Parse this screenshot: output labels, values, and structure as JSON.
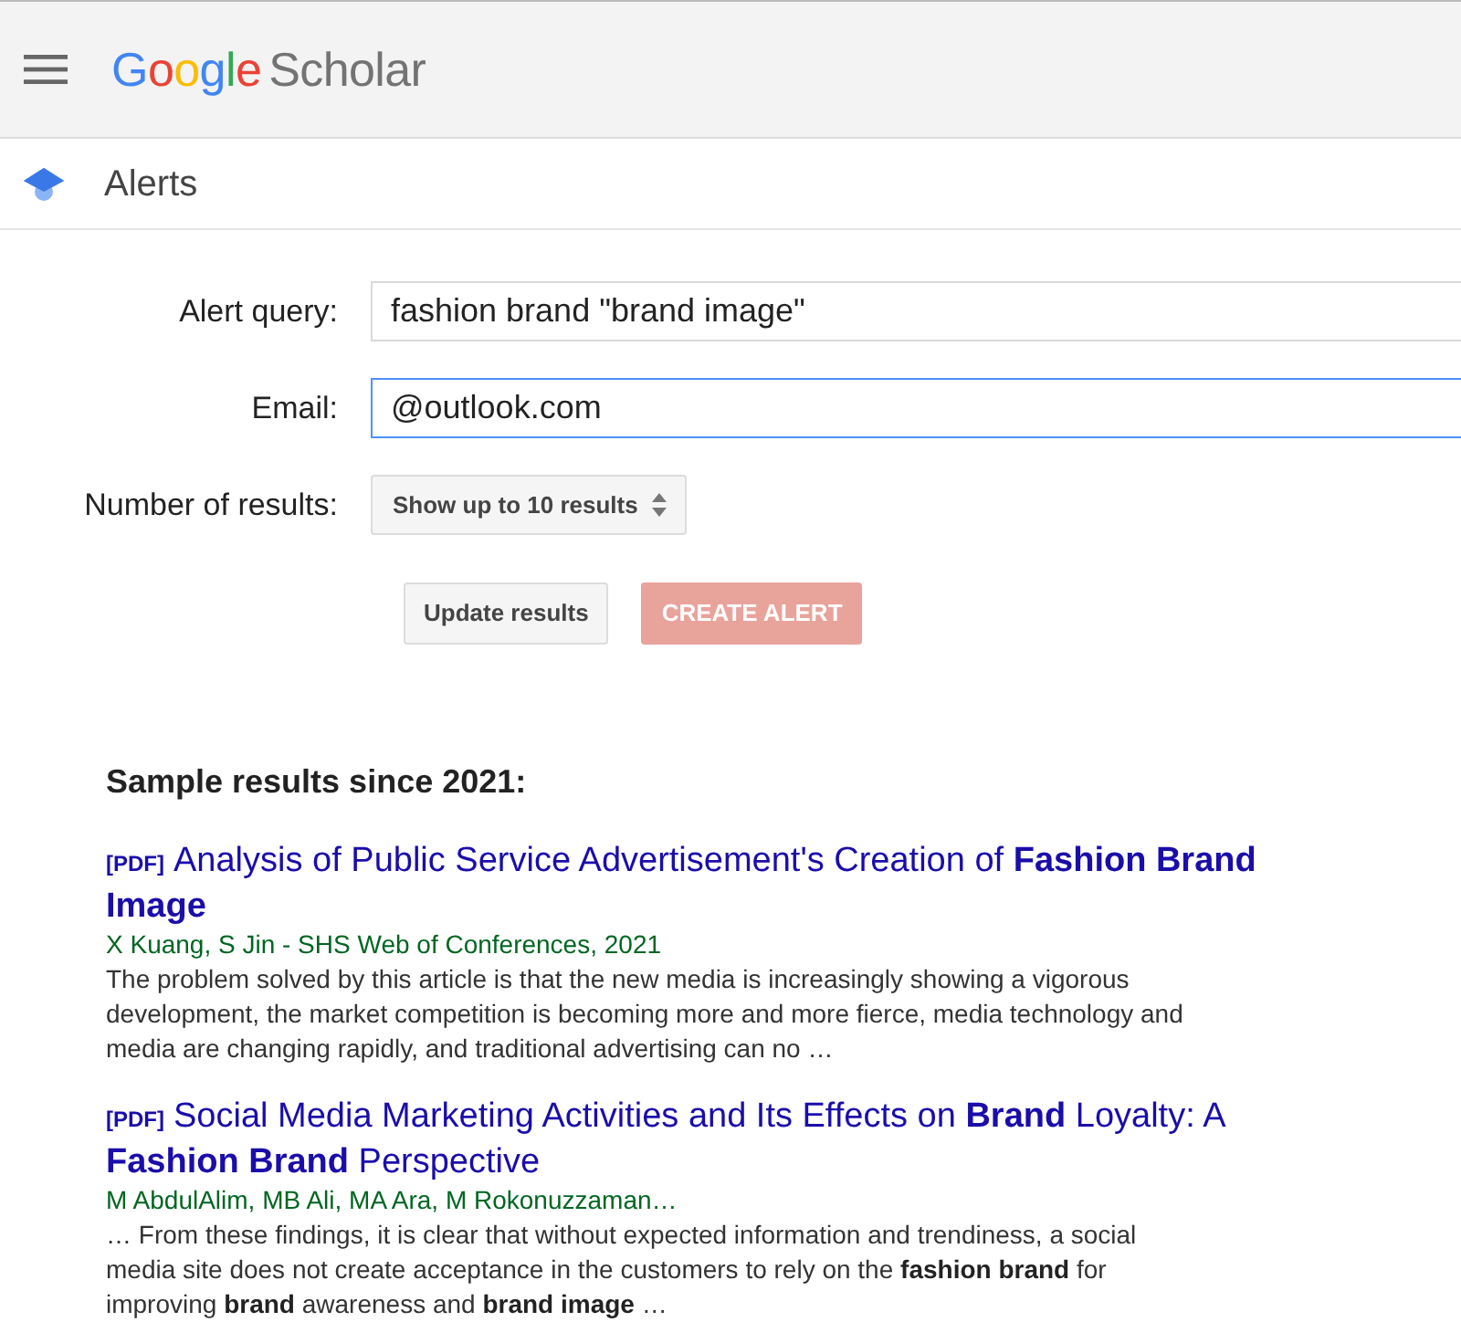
{
  "header": {
    "logo_google": "Google",
    "logo_product": "Scholar"
  },
  "page_title": "Alerts",
  "form": {
    "fields": [
      {
        "label": "Alert query:",
        "value": "fashion brand \"brand image\"",
        "focused": false
      },
      {
        "label": "Email:",
        "value": "@outlook.com",
        "focused": true
      }
    ],
    "results_label": "Number of results:",
    "results_choice": "Show up to 10 results",
    "buttons": [
      {
        "label": "Update results",
        "kind": "secondary",
        "disabled": false
      },
      {
        "label": "CREATE ALERT",
        "kind": "primary",
        "disabled": true
      }
    ]
  },
  "sample_heading": "Sample results since 2021:",
  "results": [
    {
      "tag": "[PDF]",
      "title": "Analysis of Public Service Advertisement's Creation of **Fashion Brand Image**",
      "authors": "X Kuang, S Jin - SHS Web of Conferences, 2021",
      "snippet": "The problem solved by this article is that the new media is increasingly showing a vigorous development, the market competition is becoming more and more fierce, media technology and media are changing rapidly, and traditional advertising can no …"
    },
    {
      "tag": "[PDF]",
      "title": "Social Media Marketing Activities and Its Effects on **Brand** Loyalty: A **Fashion Brand** Perspective",
      "authors": "M AbdulAlim, MB Ali, MA Ara, M Rokonuzzaman…",
      "snippet": "… From these findings, it is clear that without expected information and trendiness, a social media site does not create acceptance in the customers to rely on the **fashion brand** for improving **brand** awareness and **brand image** …"
    }
  ]
}
